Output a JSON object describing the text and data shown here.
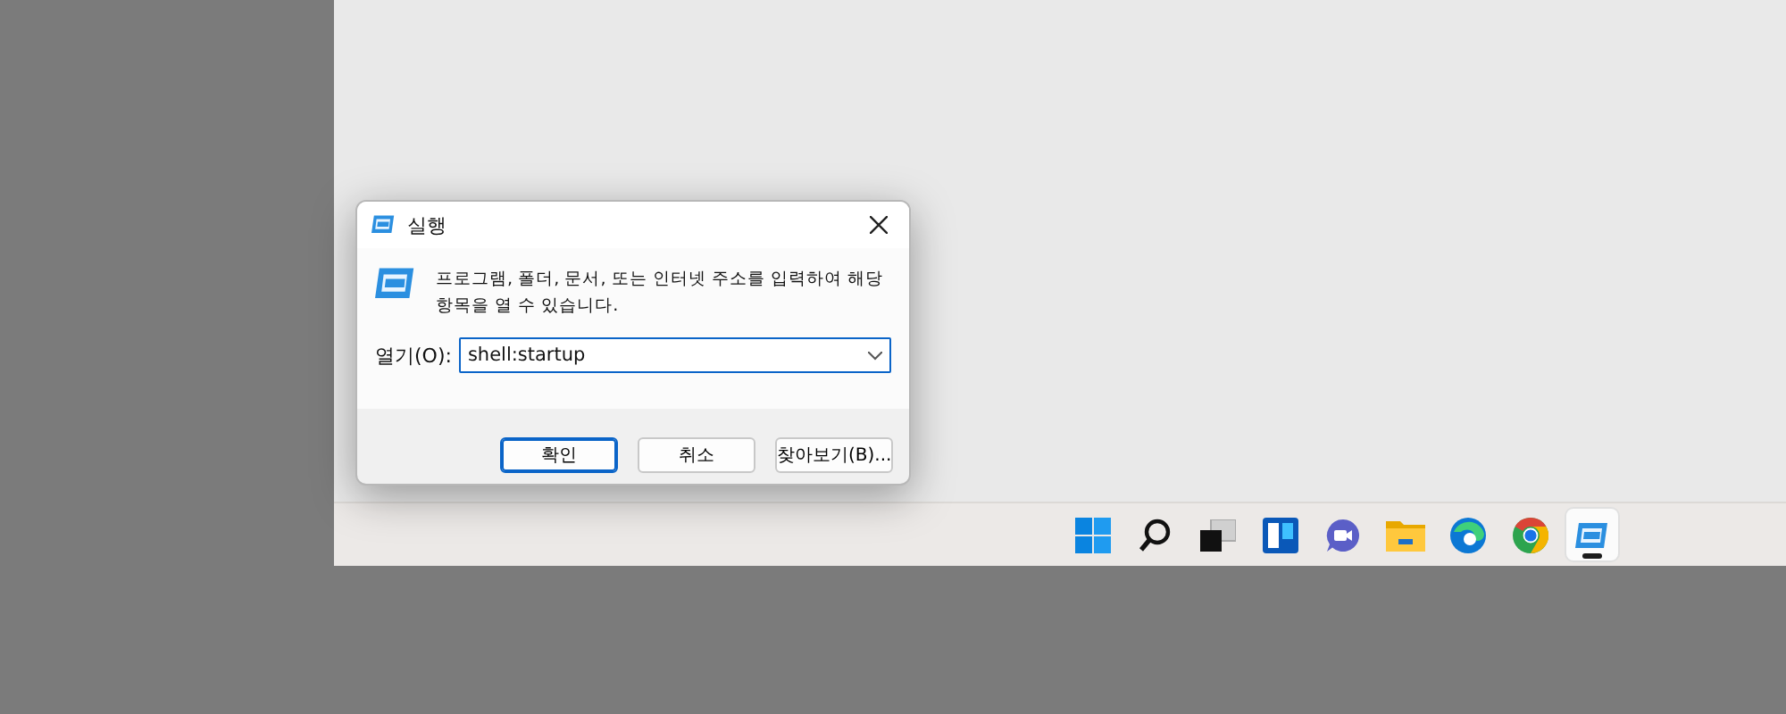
{
  "dialog": {
    "title": "실행",
    "message": "프로그램, 폴더, 문서, 또는 인터넷 주소를 입력하여 해당 항목을 열 수 있습니다.",
    "open_label": "열기(O):",
    "open_value": "shell:startup",
    "buttons": [
      {
        "label": "확인",
        "default": true
      },
      {
        "label": "취소",
        "default": false
      },
      {
        "label": "찾아보기(B)...",
        "default": false
      }
    ]
  },
  "taskbar": {
    "items": [
      {
        "kind": "start",
        "selected": false
      },
      {
        "kind": "search",
        "selected": false
      },
      {
        "kind": "taskview",
        "selected": false
      },
      {
        "kind": "widgets",
        "selected": false
      },
      {
        "kind": "chat",
        "selected": false
      },
      {
        "kind": "folder",
        "selected": false
      },
      {
        "kind": "edge",
        "selected": false
      },
      {
        "kind": "chrome",
        "selected": false
      },
      {
        "kind": "run",
        "selected": true
      }
    ]
  }
}
